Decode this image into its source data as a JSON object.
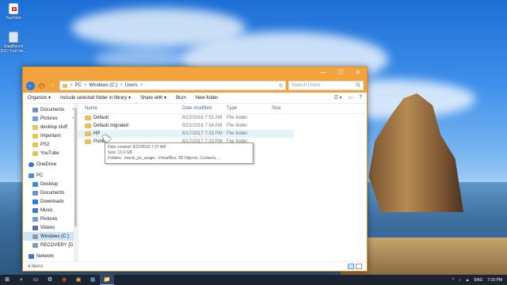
{
  "desktop": {
    "icons": [
      {
        "label": "YouTube",
        "icon": "youtube-icon"
      },
      {
        "label": "DataBench 2017 Full Dis...",
        "icon": "file-icon"
      }
    ]
  },
  "window": {
    "title_buttons": {
      "minimize": "—",
      "maximize": "☐",
      "close": "✕"
    },
    "nav": {
      "back": "←",
      "forward": "→",
      "up": "↑"
    },
    "address": {
      "parts": [
        "PC",
        "Windows (C:)",
        "Users"
      ],
      "separator": ">",
      "refresh": "↻"
    },
    "search": {
      "placeholder": "Search Users",
      "icon": "search-icon"
    },
    "commands": [
      "Organize ▾",
      "Include selected folder in library ▾",
      "Share with ▾",
      "Burn",
      "New folder"
    ],
    "cmd_right": {
      "view": "☰ ▾",
      "pane": "▭",
      "help": "?"
    },
    "sidebar": {
      "quick_access": [
        {
          "label": "Documents",
          "pinned": true
        },
        {
          "label": "Pictures",
          "pinned": true
        },
        {
          "label": "desktop stuff",
          "pinned": false
        },
        {
          "label": "Important",
          "pinned": false
        },
        {
          "label": "PS2",
          "pinned": false
        },
        {
          "label": "YouTube",
          "pinned": false
        }
      ],
      "onedrive": "OneDrive",
      "pc": "PC",
      "pc_items": [
        "Desktop",
        "Documents",
        "Downloads",
        "Music",
        "Pictures",
        "Videos",
        "Windows (C:)",
        "RECOVERY (D:)"
      ],
      "selected": "Windows (C:)",
      "network": "Network",
      "pin_glyph": "✎"
    },
    "columns": {
      "name": "Name",
      "date": "Date modified",
      "type": "Type",
      "size": "Size",
      "sort_arrow": "^"
    },
    "files": [
      {
        "name": "Default",
        "date": "9/22/2016 7:51 AM",
        "type": "File folder"
      },
      {
        "name": "Default.migrated",
        "date": "9/22/2016 7:34 AM",
        "type": "File folder"
      },
      {
        "name": "HP",
        "date": "6/17/2017 7:33 PM",
        "type": "File folder"
      },
      {
        "name": "Public",
        "date": "6/17/2017 7:33 PM",
        "type": "File folder"
      }
    ],
    "hovered_row": 2,
    "tooltip": {
      "created": "Date created: 9/22/2016 7:27 AM",
      "size": "Size: 13.6 GB",
      "folders": "Folders: .oracle_jre_usage, .VirtualBox, 3D Objects, Contacts, ..."
    },
    "status": "4 items"
  },
  "taskbar": {
    "start": "⊞",
    "apps": [
      "⌕",
      "▭",
      "⚙",
      "◉",
      "▣",
      "▦",
      "📁"
    ],
    "tray": {
      "language": "ENG",
      "time": "7:15 PM",
      "icons": [
        "^",
        "♪",
        "▲"
      ]
    }
  },
  "colors": {
    "accent": "#f2a33c",
    "selection": "#cde6f7",
    "folder": "#e8c15a"
  }
}
